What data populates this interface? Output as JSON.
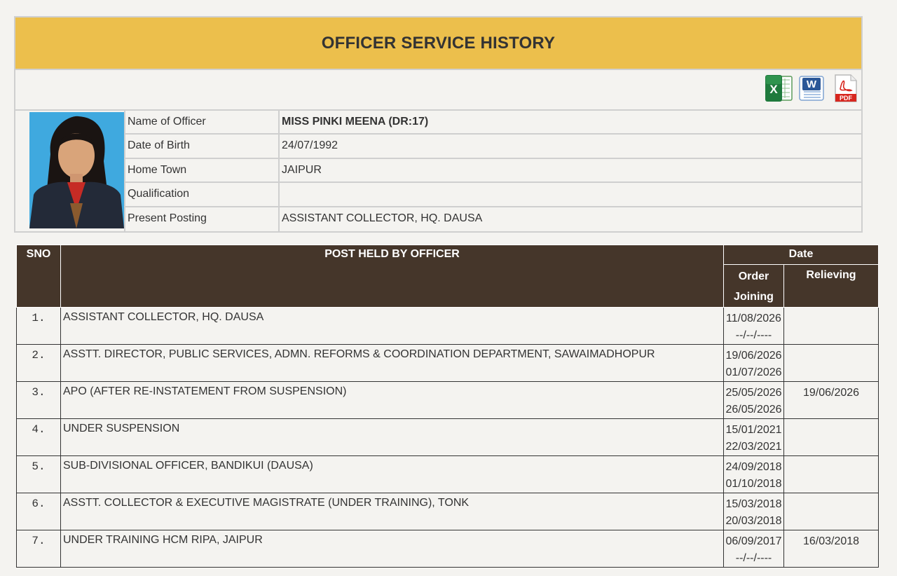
{
  "page": {
    "title": "OFFICER SERVICE HISTORY"
  },
  "exports": [
    {
      "icon": "excel-icon",
      "color": "#1f7a3d"
    },
    {
      "icon": "word-icon",
      "color": "#2b5797"
    },
    {
      "icon": "pdf-icon",
      "color": "#d7261e",
      "text": "PDF"
    }
  ],
  "officer": {
    "fields": [
      {
        "label": "Name of Officer",
        "value": "MISS PINKI MEENA (DR:17)"
      },
      {
        "label": "Date of Birth",
        "value": "24/07/1992"
      },
      {
        "label": "Home Town",
        "value": "JAIPUR"
      },
      {
        "label": "Qualification",
        "value": ""
      },
      {
        "label": "Present Posting",
        "value": "ASSISTANT COLLECTOR, HQ. DAUSA"
      }
    ]
  },
  "history": {
    "headers": {
      "sno": "SNO",
      "post": "POST HELD BY OFFICER",
      "date": "Date",
      "order_joining": "Order Joining",
      "relieving": "Relieving"
    },
    "rows": [
      {
        "sno": "1.",
        "post": "ASSISTANT COLLECTOR, HQ. DAUSA",
        "order": "11/08/2026",
        "joining": "--/--/----",
        "relieving": ""
      },
      {
        "sno": "2.",
        "post": "ASSTT. DIRECTOR, PUBLIC SERVICES, ADMN. REFORMS & COORDINATION DEPARTMENT, SAWAIMADHOPUR",
        "order": "19/06/2026",
        "joining": "01/07/2026",
        "relieving": ""
      },
      {
        "sno": "3.",
        "post": "APO (AFTER RE-INSTATEMENT FROM SUSPENSION)",
        "order": "25/05/2026",
        "joining": "26/05/2026",
        "relieving": "19/06/2026"
      },
      {
        "sno": "4.",
        "post": "UNDER SUSPENSION",
        "order": "15/01/2021",
        "joining": "22/03/2021",
        "relieving": ""
      },
      {
        "sno": "5.",
        "post": "SUB-DIVISIONAL OFFICER, BANDIKUI (DAUSA)",
        "order": "24/09/2018",
        "joining": "01/10/2018",
        "relieving": ""
      },
      {
        "sno": "6.",
        "post": "ASSTT. COLLECTOR & EXECUTIVE MAGISTRATE (UNDER TRAINING), TONK",
        "order": "15/03/2018",
        "joining": "20/03/2018",
        "relieving": ""
      },
      {
        "sno": "7.",
        "post": "UNDER TRAINING HCM RIPA, JAIPUR",
        "order": "06/09/2017",
        "joining": "--/--/----",
        "relieving": "16/03/2018"
      }
    ]
  }
}
